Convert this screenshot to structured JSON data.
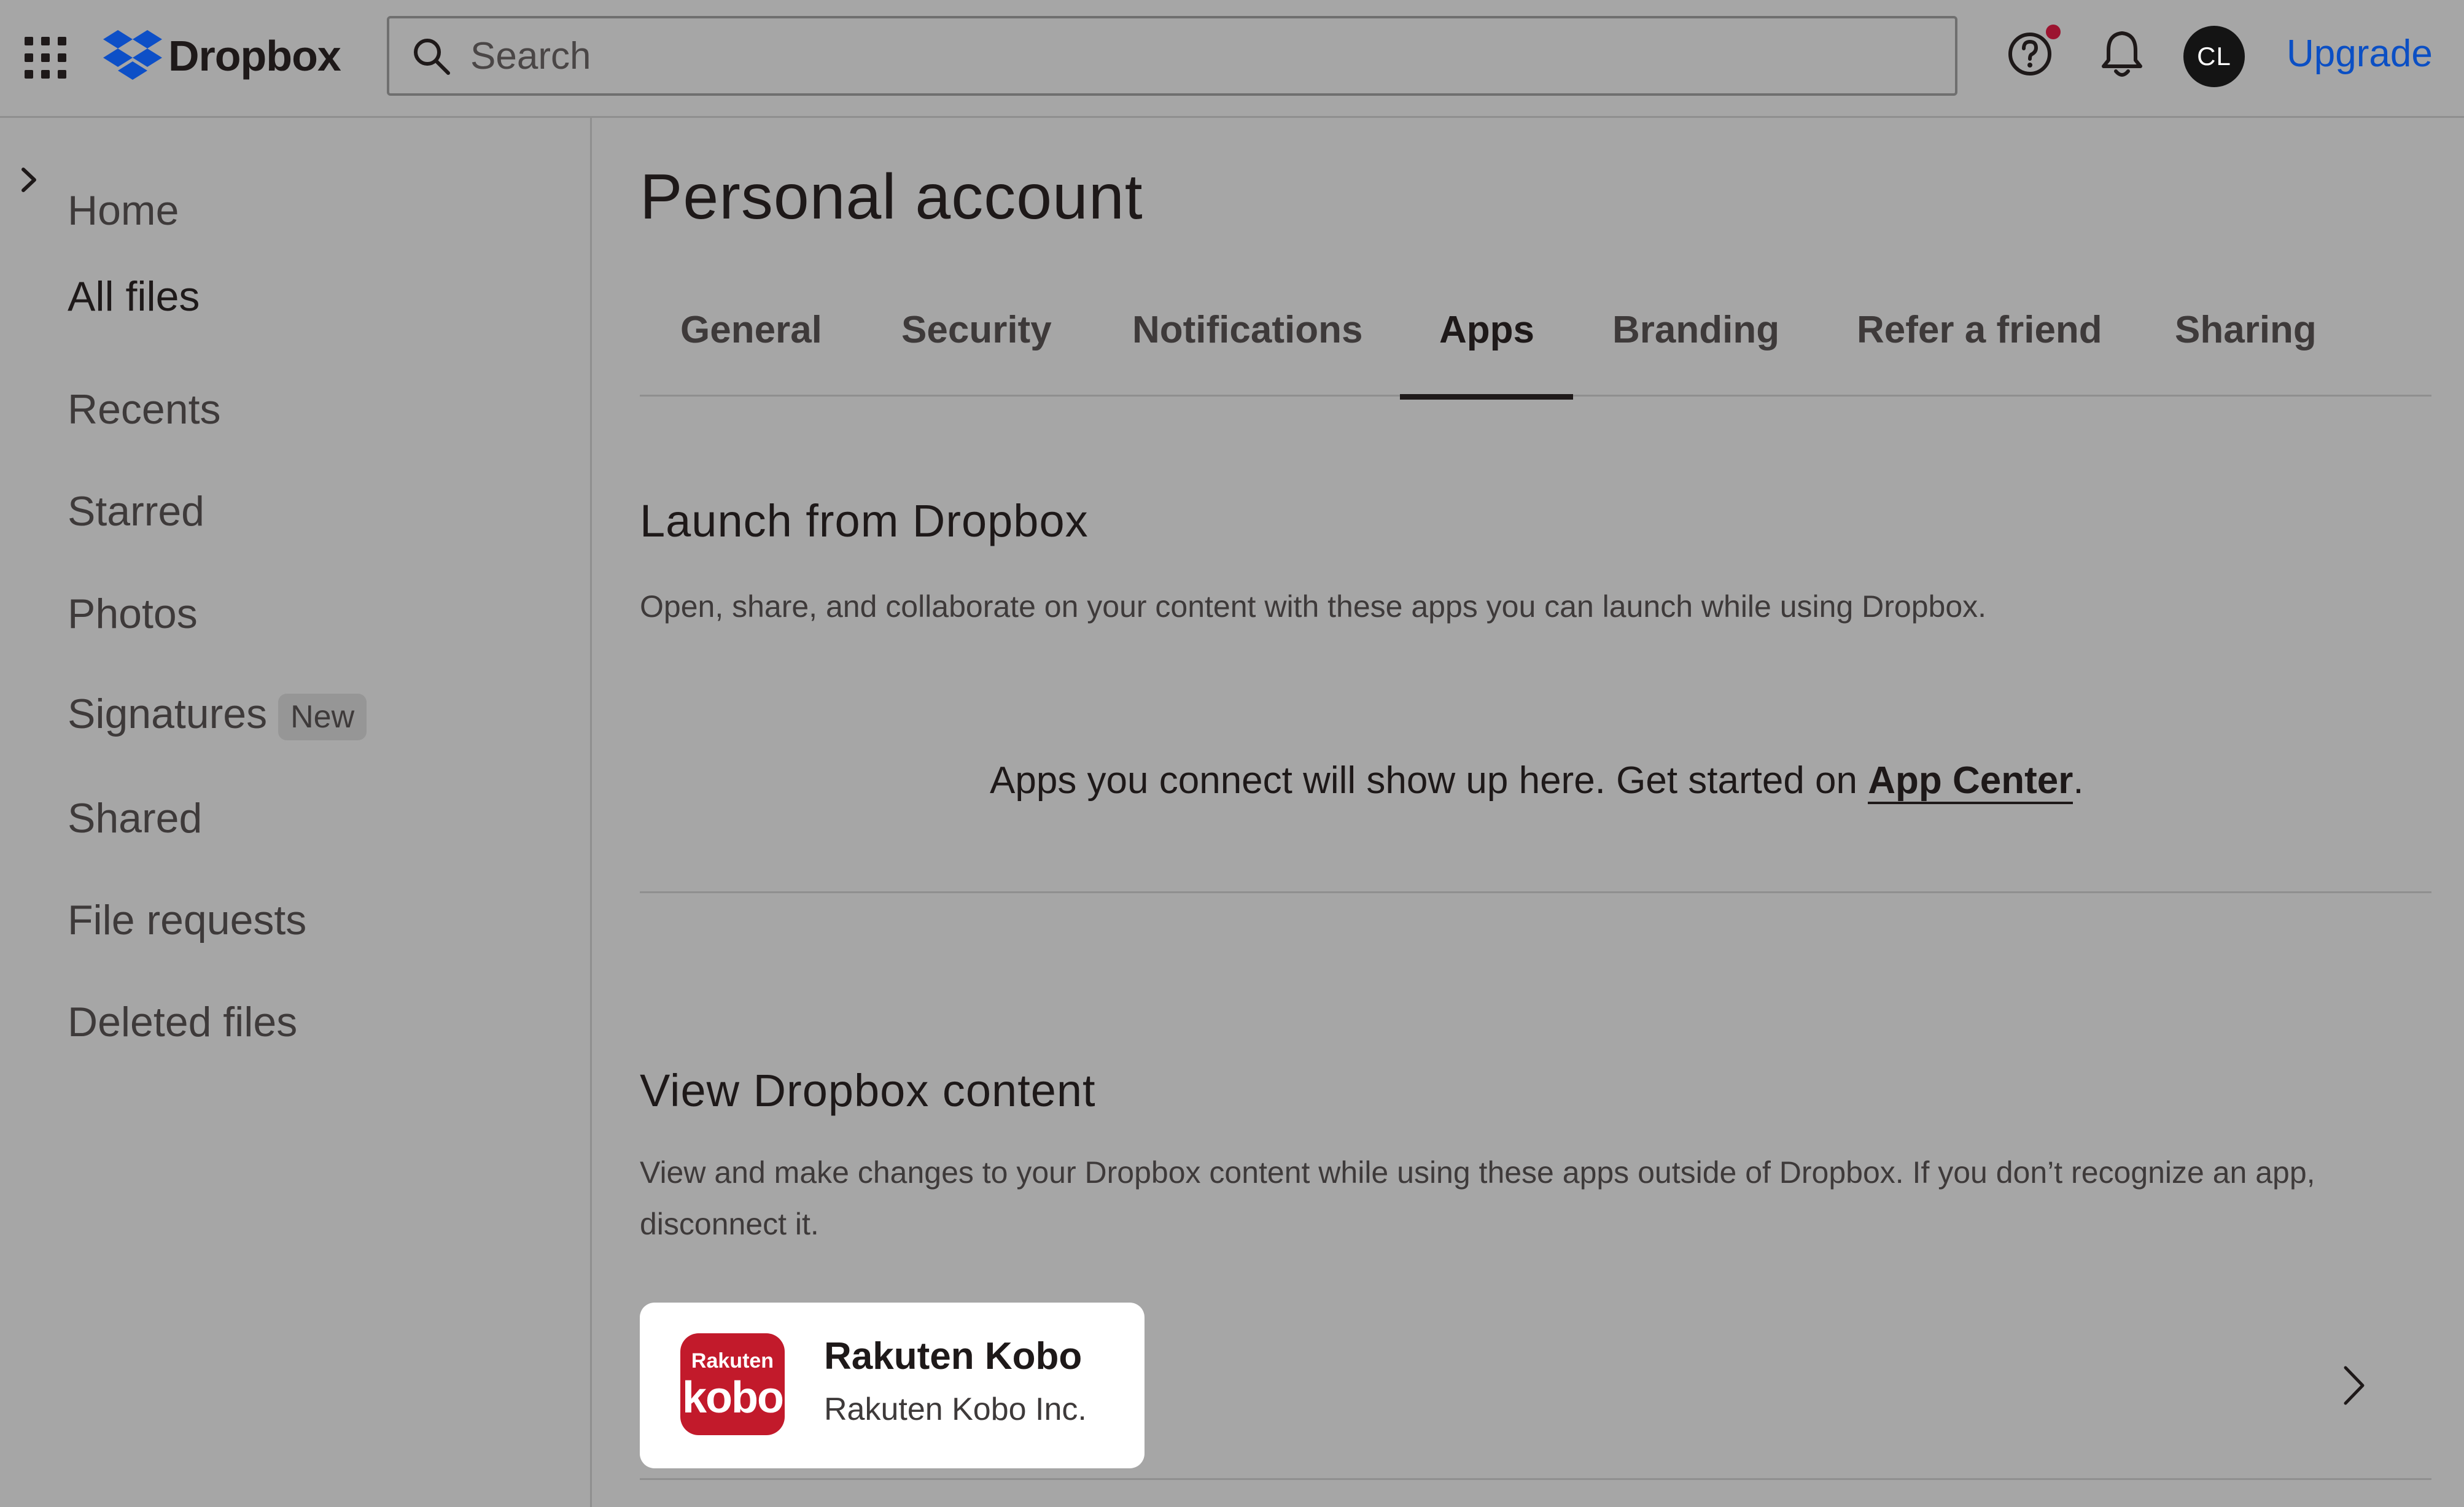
{
  "header": {
    "brand": "Dropbox",
    "search_placeholder": "Search",
    "avatar_initials": "CL",
    "upgrade_label": "Upgrade"
  },
  "sidebar": {
    "items": [
      {
        "label": "Home"
      },
      {
        "label": "All files"
      },
      {
        "label": "Recents"
      },
      {
        "label": "Starred"
      },
      {
        "label": "Photos"
      },
      {
        "label": "Signatures",
        "badge": "New"
      },
      {
        "label": "Shared"
      },
      {
        "label": "File requests"
      },
      {
        "label": "Deleted files"
      }
    ]
  },
  "main": {
    "title": "Personal account",
    "tabs": [
      {
        "label": "General"
      },
      {
        "label": "Security"
      },
      {
        "label": "Notifications"
      },
      {
        "label": "Apps"
      },
      {
        "label": "Branding"
      },
      {
        "label": "Refer a friend"
      },
      {
        "label": "Sharing"
      }
    ],
    "active_tab": "Apps",
    "launch": {
      "title": "Launch from Dropbox",
      "description": "Open, share, and collaborate on your content with these apps you can launch while using Dropbox.",
      "empty_text": "Apps you connect will show up here. Get started on ",
      "empty_link": "App Center",
      "empty_suffix": "."
    },
    "view": {
      "title": "View Dropbox content",
      "description": "View and make changes to your Dropbox content while using these apps outside of Dropbox. If you don’t recognize an app, disconnect it.",
      "apps": [
        {
          "name": "Rakuten Kobo",
          "developer": "Rakuten Kobo Inc.",
          "logo_top": "Rakuten",
          "logo_bottom": "kobo"
        }
      ]
    }
  },
  "colors": {
    "link_blue": "#0b4fc4",
    "notification_dot": "#9c1430",
    "kobo_red": "#c21a2b",
    "dropbox_blue": "#0d4fc7"
  }
}
